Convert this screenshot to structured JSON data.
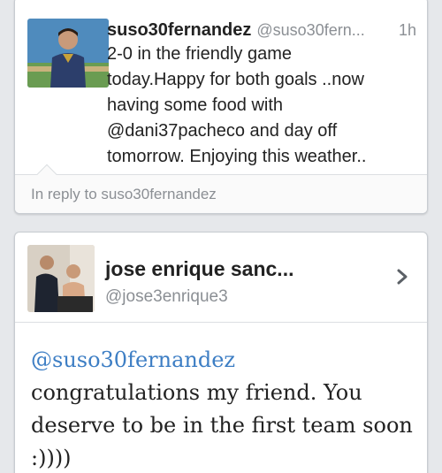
{
  "tweet": {
    "username": "suso30fernandez",
    "handle": "@suso30fern...",
    "time": "1h",
    "lines": [
      "2-0 in the friendly game",
      "today.Happy for both goals ..now",
      "having some food with",
      "@dani37pacheco and day off",
      "tomorrow. Enjoying this weather.."
    ],
    "reply_to": "In reply to suso30fernandez"
  },
  "reply": {
    "name": "jose enrique sanc...",
    "handle": "@jose3enrique3",
    "mention": "@suso30fernandez",
    "lines": [
      "congratulations my friend. You",
      "deserve to be in the first team soon",
      ":))))"
    ]
  },
  "colors": {
    "background": "#e6e8eb",
    "link": "#3d7ec4",
    "muted": "#8b8f94"
  },
  "icons": {
    "chevron": "chevron-right-icon"
  }
}
